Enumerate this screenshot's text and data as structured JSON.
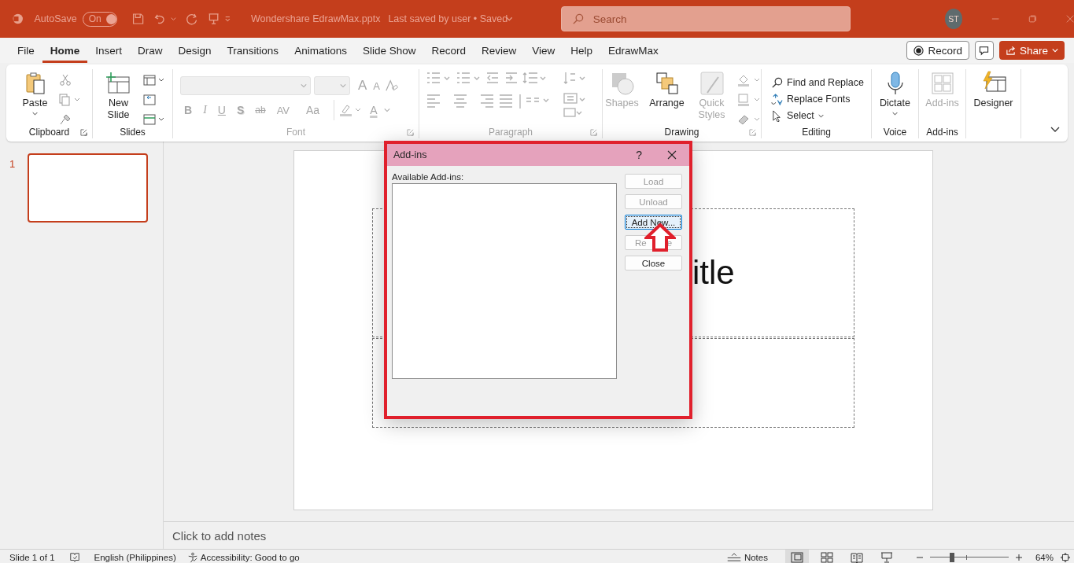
{
  "title_bar": {
    "autosave_label": "AutoSave",
    "autosave_toggle": {
      "label": "On",
      "on": true
    },
    "document_title": "Wondershare EdrawMax.pptx",
    "save_status": "Last saved by user • Saved",
    "search": {
      "placeholder": "Search"
    },
    "avatar": "ST"
  },
  "tabs": [
    {
      "label": "File",
      "selected": false
    },
    {
      "label": "Home",
      "selected": true
    },
    {
      "label": "Insert",
      "selected": false
    },
    {
      "label": "Draw",
      "selected": false
    },
    {
      "label": "Design",
      "selected": false
    },
    {
      "label": "Transitions",
      "selected": false
    },
    {
      "label": "Animations",
      "selected": false
    },
    {
      "label": "Slide Show",
      "selected": false
    },
    {
      "label": "Record",
      "selected": false
    },
    {
      "label": "Review",
      "selected": false
    },
    {
      "label": "View",
      "selected": false
    },
    {
      "label": "Help",
      "selected": false
    },
    {
      "label": "EdrawMax",
      "selected": false
    }
  ],
  "ribbon_actions": {
    "record": "Record",
    "share": "Share"
  },
  "ribbon": {
    "clipboard": {
      "label": "Clipboard",
      "paste": "Paste"
    },
    "slides": {
      "label": "Slides",
      "new_slide": "New Slide"
    },
    "font": {
      "label": "Font",
      "disabled": true,
      "grow": "A",
      "shrink": "A",
      "styles": [
        "B",
        "I",
        "U",
        "S",
        "ab",
        "AV",
        "Aa"
      ],
      "font_color": "A"
    },
    "paragraph": {
      "label": "Paragraph",
      "disabled": true
    },
    "drawing": {
      "label": "Drawing",
      "buttons": [
        {
          "label": "Shapes",
          "disabled": true
        },
        {
          "label": "Arrange",
          "disabled": false
        },
        {
          "label": "Quick Styles",
          "disabled": true
        }
      ]
    },
    "editing": {
      "label": "Editing",
      "items": [
        {
          "label": "Find and Replace",
          "kind": "find"
        },
        {
          "label": "Replace Fonts",
          "kind": "replace"
        },
        {
          "label": "Select",
          "kind": "select"
        }
      ]
    },
    "voice": {
      "label": "Voice",
      "dictate": "Dictate"
    },
    "addins": {
      "label": "Add-ins",
      "button": {
        "label": "Add-ins",
        "disabled": true
      }
    },
    "designer": {
      "button": "Designer"
    }
  },
  "slide_panel": {
    "slides": [
      {
        "number": "1",
        "selected": true
      }
    ]
  },
  "slide": {
    "title_fragment": "itle"
  },
  "dialog": {
    "title": "Add-ins",
    "help": "?",
    "list_label": "Available Add-ins:",
    "buttons": [
      {
        "label": "Load",
        "disabled": true,
        "focused": false
      },
      {
        "label": "Unload",
        "disabled": true,
        "focused": false
      },
      {
        "label": "Add New...",
        "disabled": false,
        "focused": true
      },
      {
        "label": "Re",
        "tail": "e",
        "disabled": true,
        "focused": false
      },
      {
        "label": "Close",
        "disabled": false,
        "focused": false
      }
    ]
  },
  "notes": {
    "placeholder": "Click to add notes"
  },
  "status_bar": {
    "slide_count": "Slide 1 of 1",
    "language": "English (Philippines)",
    "accessibility": "Accessibility: Good to go",
    "notes_button": "Notes",
    "views": [
      {
        "kind": "normal",
        "selected": true
      },
      {
        "kind": "sorter",
        "selected": false
      },
      {
        "kind": "reading",
        "selected": false
      },
      {
        "kind": "slideshow",
        "selected": false
      }
    ],
    "zoom": {
      "level": 0.28,
      "label": "64%"
    }
  }
}
